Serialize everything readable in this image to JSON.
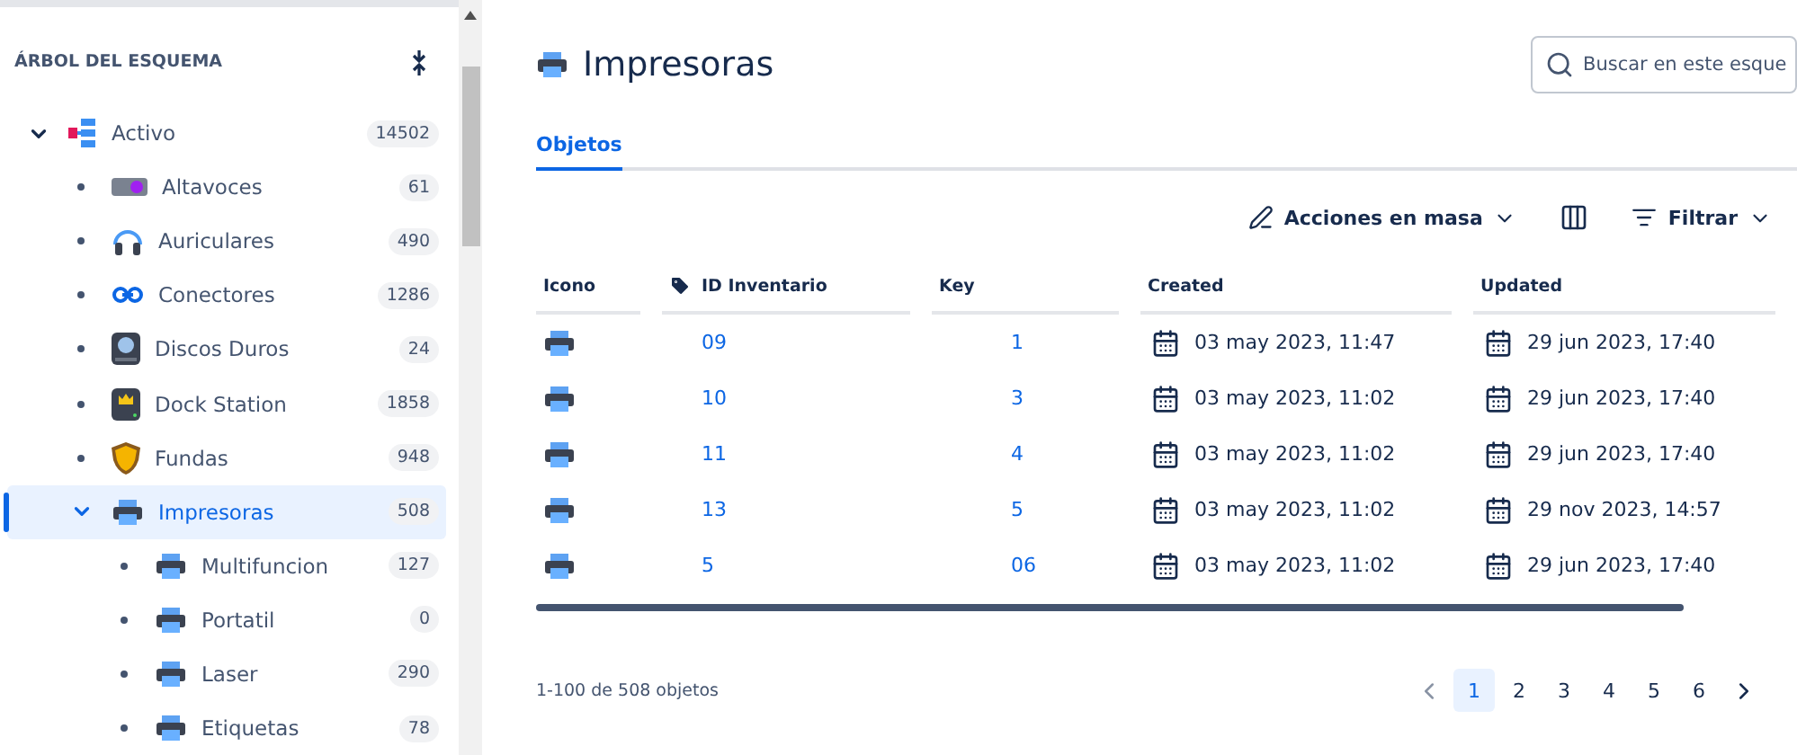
{
  "sidebar": {
    "title": "ÁRBOL DEL ESQUEMA",
    "tree": [
      {
        "label": "Activo",
        "count": "14502",
        "kind": "group",
        "expanded": true,
        "selected": false,
        "children": [
          {
            "label": "Altavoces",
            "count": "61",
            "kind": "speaker",
            "selected": false
          },
          {
            "label": "Auriculares",
            "count": "490",
            "kind": "headphones",
            "selected": false
          },
          {
            "label": "Conectores",
            "count": "1286",
            "kind": "connector",
            "selected": false
          },
          {
            "label": "Discos Duros",
            "count": "24",
            "kind": "drive",
            "selected": false
          },
          {
            "label": "Dock Station",
            "count": "1858",
            "kind": "dock",
            "selected": false
          },
          {
            "label": "Fundas",
            "count": "948",
            "kind": "shield",
            "selected": false
          },
          {
            "label": "Impresoras",
            "count": "508",
            "kind": "printer",
            "expanded": true,
            "selected": true,
            "children": [
              {
                "label": "Multifuncion",
                "count": "127",
                "kind": "printer",
                "selected": false
              },
              {
                "label": "Portatil",
                "count": "0",
                "kind": "printer",
                "selected": false
              },
              {
                "label": "Laser",
                "count": "290",
                "kind": "printer",
                "selected": false
              },
              {
                "label": "Etiquetas",
                "count": "78",
                "kind": "printer",
                "selected": false
              }
            ]
          }
        ]
      }
    ]
  },
  "header": {
    "title": "Impresoras",
    "search": {
      "placeholder": "Buscar en este esque"
    }
  },
  "tabs": [
    {
      "label": "Objetos",
      "selected": true
    }
  ],
  "toolbar": {
    "bulk_actions": "Acciones en masa",
    "filter": "Filtrar"
  },
  "table": {
    "columns": [
      "Icono",
      "ID Inventario",
      "Key",
      "Created",
      "Updated"
    ],
    "rows": [
      {
        "id": "09",
        "key": "1",
        "created": "03 may 2023, 11:47",
        "updated": "29 jun 2023, 17:40"
      },
      {
        "id": "10",
        "key": "3",
        "created": "03 may 2023, 11:02",
        "updated": "29 jun 2023, 17:40"
      },
      {
        "id": "11",
        "key": "4",
        "created": "03 may 2023, 11:02",
        "updated": "29 jun 2023, 17:40"
      },
      {
        "id": "13",
        "key": "5",
        "created": "03 may 2023, 11:02",
        "updated": "29 nov 2023, 14:57"
      },
      {
        "id": "5",
        "key": "06",
        "created": "03 may 2023, 11:02",
        "updated": "29 jun 2023, 17:40"
      }
    ]
  },
  "footer": {
    "summary": "1-100 de 508 objetos",
    "pages": [
      {
        "label": "1",
        "selected": true
      },
      {
        "label": "2",
        "selected": false
      },
      {
        "label": "3",
        "selected": false
      },
      {
        "label": "4",
        "selected": false
      },
      {
        "label": "5",
        "selected": false
      },
      {
        "label": "6",
        "selected": false
      }
    ]
  }
}
